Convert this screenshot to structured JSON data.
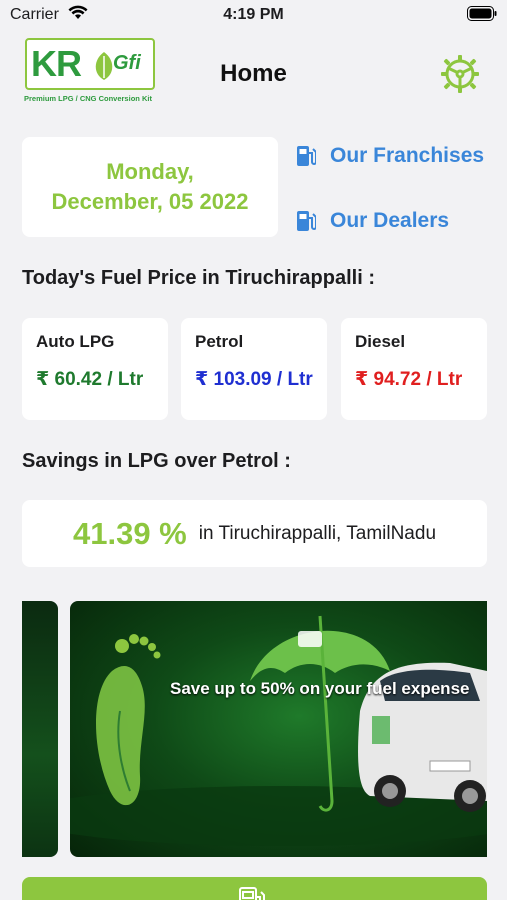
{
  "status_bar": {
    "carrier": "Carrier",
    "time": "4:19 PM"
  },
  "header": {
    "logo_text": "KR",
    "logo_sub": "Gfi",
    "logo_tagline": "Premium LPG / CNG Conversion Kit",
    "title": "Home"
  },
  "date": {
    "line1": "Monday,",
    "line2": "December, 05 2022"
  },
  "links": {
    "franchises": "Our Franchises",
    "dealers": "Our Dealers"
  },
  "fuel": {
    "section_title": "Today's Fuel Price in Tiruchirappalli :",
    "items": [
      {
        "name": "Auto LPG",
        "price": "₹ 60.42 / Ltr",
        "color": "#1f7a2e"
      },
      {
        "name": "Petrol",
        "price": "₹ 103.09 / Ltr",
        "color": "#1f2fd1"
      },
      {
        "name": "Diesel",
        "price": "₹ 94.72 / Ltr",
        "color": "#e01f1f"
      }
    ]
  },
  "savings": {
    "section_title": "Savings in LPG over Petrol :",
    "percent": "41.39 %",
    "location": "in Tiruchirappalli, TamilNadu"
  },
  "banner": {
    "text": "Save up to 50% on your fuel expense"
  },
  "colors": {
    "accent": "#8dc63f",
    "link": "#3a86d9",
    "background": "#f2f2f4"
  }
}
